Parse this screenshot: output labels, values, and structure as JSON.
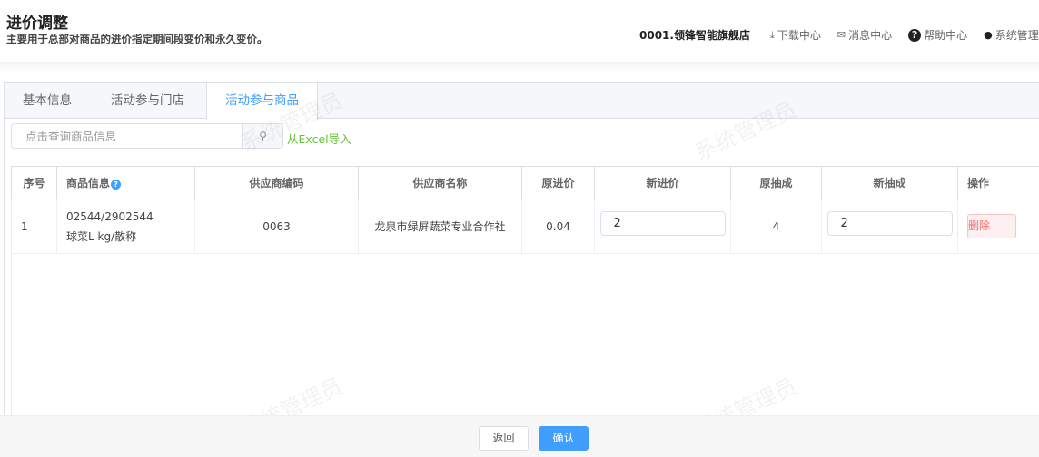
{
  "header": {
    "title": "进价调整",
    "subtitle": "主要用于总部对商品的进价指定期间段变价和永久变价。",
    "store": "0001.领锋智能旗舰店",
    "nav": [
      {
        "label": "下载中心",
        "icon": "download-icon"
      },
      {
        "label": "消息中心",
        "icon": "mail-icon"
      },
      {
        "label": "帮助中心",
        "icon": "help-icon"
      },
      {
        "label": "系统管理",
        "icon": "user-icon"
      }
    ]
  },
  "tabs": [
    {
      "label": "基本信息"
    },
    {
      "label": "活动参与门店"
    },
    {
      "label": "活动参与商品",
      "active": true
    }
  ],
  "search": {
    "placeholder": "点击查询商品信息",
    "import_label": "从Excel导入"
  },
  "table": {
    "columns": [
      "序号",
      "商品信息",
      "供应商编码",
      "供应商名称",
      "原进价",
      "新进价",
      "原抽成",
      "新抽成",
      "操作"
    ],
    "rows": [
      {
        "index": "1",
        "code": "02544/2902544",
        "name": "球菜L kg/散称",
        "supplier_code": "0063",
        "supplier_name": "龙泉市绿屏蔬菜专业合作社",
        "old_price": "0.04",
        "new_price": "2",
        "old_commission": "4",
        "new_commission": "2",
        "action": "删除"
      }
    ]
  },
  "footer": {
    "back": "返回",
    "confirm": "确认"
  },
  "watermark": "系统管理员",
  "colors": {
    "accent": "#409eff",
    "success": "#67c23a",
    "danger": "#f56c6c"
  }
}
